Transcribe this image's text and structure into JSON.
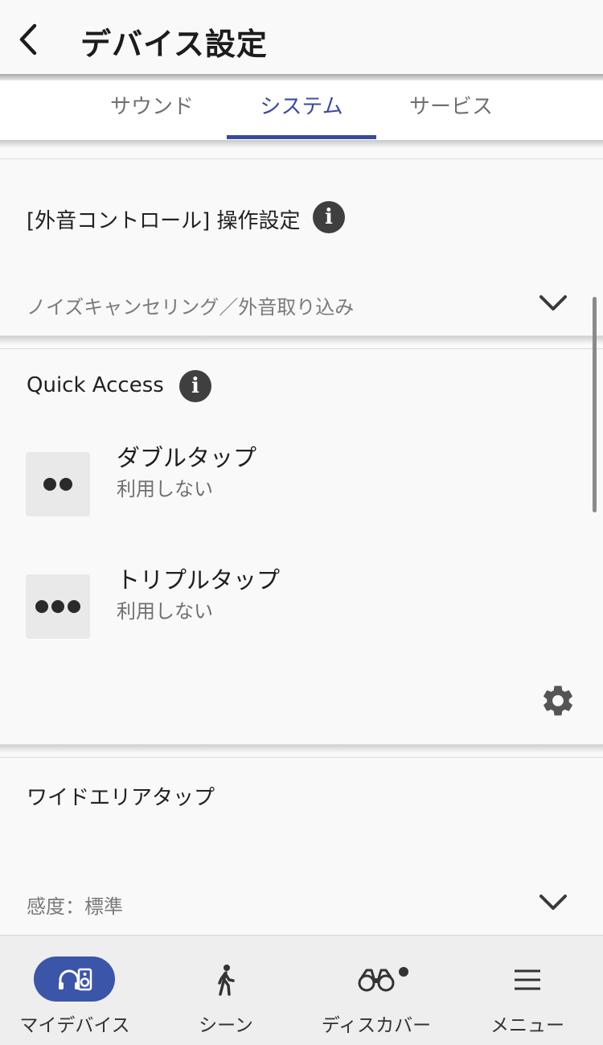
{
  "header": {
    "title": "デバイス設定",
    "back_icon": "chevron-left-icon"
  },
  "tabs": [
    {
      "label": "サウンド",
      "active": false
    },
    {
      "label": "システム",
      "active": true
    },
    {
      "label": "サービス",
      "active": false
    }
  ],
  "ambient_control": {
    "title": "[外音コントロール] 操作設定",
    "info_glyph": "i",
    "dropdown_value": "ノイズキャンセリング／外音取り込み"
  },
  "quick_access": {
    "title": "Quick Access",
    "info_glyph": "i",
    "items": [
      {
        "name": "ダブルタップ",
        "value": "利用しない",
        "icon": "double-dot-icon"
      },
      {
        "name": "トリプルタップ",
        "value": "利用しない",
        "icon": "triple-dot-icon"
      }
    ],
    "settings_icon": "gear-icon"
  },
  "wide_area_tap": {
    "title": "ワイドエリアタップ",
    "dropdown_value": "感度：標準"
  },
  "bottom_nav": [
    {
      "label": "マイデバイス",
      "icon": "headphones-speaker-icon",
      "active": true
    },
    {
      "label": "シーン",
      "icon": "walking-person-icon",
      "active": false
    },
    {
      "label": "ディスカバー",
      "icon": "binoculars-icon",
      "active": false,
      "badge": true
    },
    {
      "label": "メニュー",
      "icon": "hamburger-menu-icon",
      "active": false
    }
  ],
  "colors": {
    "accent": "#3a4a9e",
    "nav_active_pill": "#3b55a8",
    "background": "#f9f9f9"
  }
}
